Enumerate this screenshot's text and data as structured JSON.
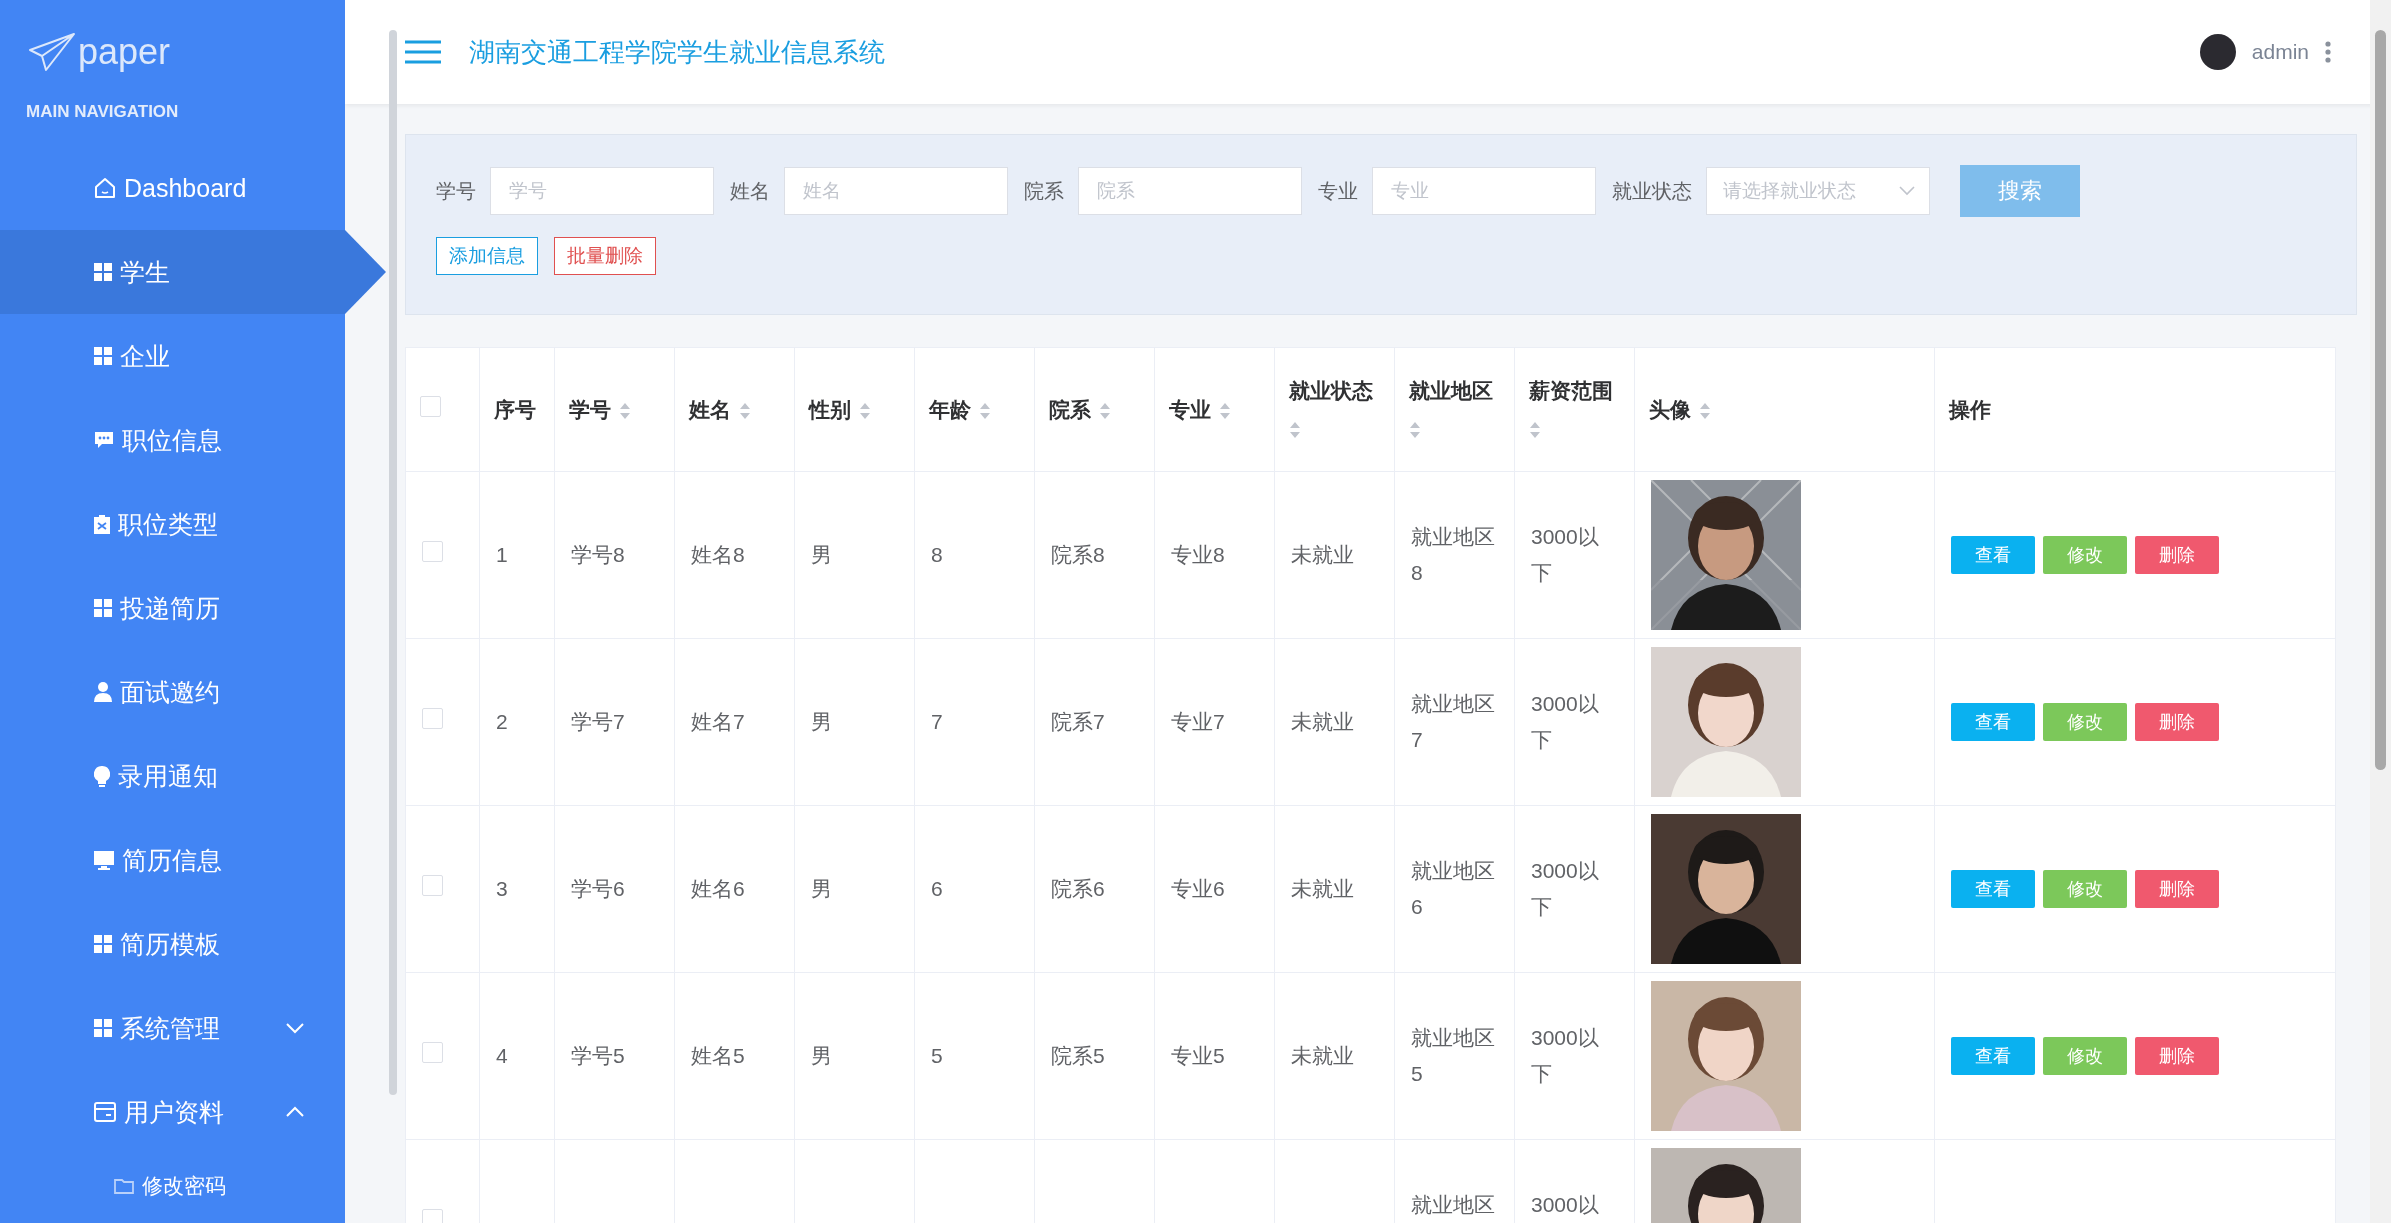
{
  "logo": {
    "text": "paper"
  },
  "sidebar": {
    "heading": "MAIN NAVIGATION",
    "items": [
      {
        "label": "Dashboard",
        "selected": false
      },
      {
        "label": "学生",
        "selected": true
      },
      {
        "label": "企业",
        "selected": false
      },
      {
        "label": "职位信息",
        "selected": false
      },
      {
        "label": "职位类型",
        "selected": false
      },
      {
        "label": "投递简历",
        "selected": false
      },
      {
        "label": "面试邀约",
        "selected": false
      },
      {
        "label": "录用通知",
        "selected": false
      },
      {
        "label": "简历信息",
        "selected": false
      },
      {
        "label": "简历模板",
        "selected": false
      },
      {
        "label": "系统管理",
        "selected": false,
        "expanded": false
      },
      {
        "label": "用户资料",
        "selected": false,
        "expanded": true,
        "children": [
          {
            "label": "修改密码",
            "selected": false
          }
        ]
      }
    ]
  },
  "header": {
    "title": "湖南交通工程学院学生就业信息系统",
    "user": "admin"
  },
  "filters": {
    "fields": [
      {
        "label": "学号",
        "placeholder": "学号"
      },
      {
        "label": "姓名",
        "placeholder": "姓名"
      },
      {
        "label": "院系",
        "placeholder": "院系"
      },
      {
        "label": "专业",
        "placeholder": "专业"
      }
    ],
    "status": {
      "label": "就业状态",
      "placeholder": "请选择就业状态"
    },
    "search_button": "搜索",
    "actions": [
      {
        "label": "添加信息",
        "kind": "add"
      },
      {
        "label": "批量删除",
        "kind": "delete"
      }
    ]
  },
  "table": {
    "select_all": {
      "checked": false
    },
    "columns": [
      {
        "label": "序号",
        "sortable": false
      },
      {
        "label": "学号",
        "sortable": true
      },
      {
        "label": "姓名",
        "sortable": true
      },
      {
        "label": "性别",
        "sortable": true
      },
      {
        "label": "年龄",
        "sortable": true
      },
      {
        "label": "院系",
        "sortable": true
      },
      {
        "label": "专业",
        "sortable": true
      },
      {
        "label": "就业状态",
        "sortable": true
      },
      {
        "label": "就业地区",
        "sortable": true
      },
      {
        "label": "薪资范围",
        "sortable": true
      },
      {
        "label": "头像",
        "sortable": true
      },
      {
        "label": "操作",
        "sortable": false
      }
    ],
    "rows": [
      {
        "checked": false,
        "cells": [
          "1",
          "学号8",
          "姓名8",
          "男",
          "8",
          "院系8",
          "专业8",
          "未就业",
          "就业地区8",
          "3000以下"
        ],
        "actions": [
          {
            "label": "查看",
            "kind": "view"
          },
          {
            "label": "修改",
            "kind": "edit"
          },
          {
            "label": "删除",
            "kind": "delete"
          }
        ]
      },
      {
        "checked": false,
        "cells": [
          "2",
          "学号7",
          "姓名7",
          "男",
          "7",
          "院系7",
          "专业7",
          "未就业",
          "就业地区7",
          "3000以下"
        ],
        "actions": [
          {
            "label": "查看",
            "kind": "view"
          },
          {
            "label": "修改",
            "kind": "edit"
          },
          {
            "label": "删除",
            "kind": "delete"
          }
        ]
      },
      {
        "checked": false,
        "cells": [
          "3",
          "学号6",
          "姓名6",
          "男",
          "6",
          "院系6",
          "专业6",
          "未就业",
          "就业地区6",
          "3000以下"
        ],
        "actions": [
          {
            "label": "查看",
            "kind": "view"
          },
          {
            "label": "修改",
            "kind": "edit"
          },
          {
            "label": "删除",
            "kind": "delete"
          }
        ]
      },
      {
        "checked": false,
        "cells": [
          "4",
          "学号5",
          "姓名5",
          "男",
          "5",
          "院系5",
          "专业5",
          "未就业",
          "就业地区5",
          "3000以下"
        ],
        "actions": [
          {
            "label": "查看",
            "kind": "view"
          },
          {
            "label": "修改",
            "kind": "edit"
          },
          {
            "label": "删除",
            "kind": "delete"
          }
        ]
      },
      {
        "checked": false,
        "cells": [
          null,
          null,
          null,
          null,
          null,
          null,
          null,
          null,
          "就业地区",
          "3000以"
        ]
      }
    ]
  }
}
